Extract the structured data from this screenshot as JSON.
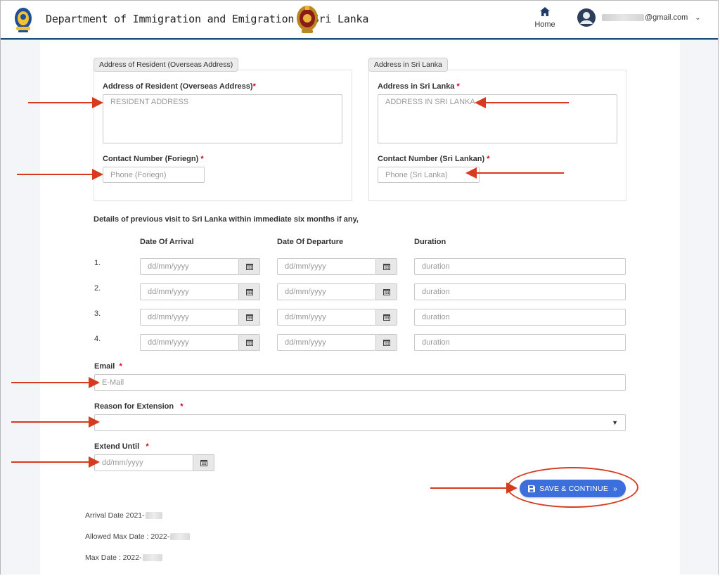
{
  "header": {
    "title": "Department of Immigration and Emigration - Sri Lanka",
    "home_label": "Home",
    "user_email_suffix": "@gmail.com"
  },
  "overseas": {
    "tag": "Address of Resident (Overseas Address)",
    "address_label": "Address of Resident (Overseas Address)",
    "address_placeholder": "RESIDENT ADDRESS",
    "phone_label": "Contact Number (Foriegn)",
    "phone_placeholder": "Phone (Foriegn)"
  },
  "srilanka": {
    "tag": "Address in Sri Lanka",
    "address_label": "Address in Sri Lanka",
    "address_placeholder": "ADDRESS IN SRI LANKA",
    "phone_label": "Contact Number (Sri Lankan)",
    "phone_placeholder": "Phone (Sri Lanka)"
  },
  "previous_visits": {
    "note": "Details of previous visit to Sri Lanka within immediate six months if any,",
    "columns": [
      "Date Of Arrival",
      "Date Of Departure",
      "Duration"
    ],
    "rows": [
      {
        "num": "1.",
        "arrival": "dd/mm/yyyy",
        "departure": "dd/mm/yyyy",
        "duration": "duration"
      },
      {
        "num": "2.",
        "arrival": "dd/mm/yyyy",
        "departure": "dd/mm/yyyy",
        "duration": "duration"
      },
      {
        "num": "3.",
        "arrival": "dd/mm/yyyy",
        "departure": "dd/mm/yyyy",
        "duration": "duration"
      },
      {
        "num": "4.",
        "arrival": "dd/mm/yyyy",
        "departure": "dd/mm/yyyy",
        "duration": "duration"
      }
    ]
  },
  "email": {
    "label": "Email",
    "placeholder": "E-Mail"
  },
  "reason": {
    "label": "Reason for Extension",
    "value": ""
  },
  "extend_until": {
    "label": "Extend Until",
    "placeholder": "dd/mm/yyyy"
  },
  "required_mark": "*",
  "save_button": {
    "label": "SAVE & CONTINUE",
    "suffix": "»"
  },
  "info": {
    "arrival_date": "Arrival Date 2021-",
    "allowed_max_date": "Allowed Max Date : 2022-",
    "max_date": "Max Date : 2022-"
  },
  "colors": {
    "accent_blue": "#3d6fdc",
    "header_rule": "#1f4d7a",
    "annotation_red": "#d63a1f",
    "required_red": "#d0021b"
  },
  "icons": {
    "home": "home-icon",
    "calendar": "calendar-icon",
    "save": "floppy-disk-icon",
    "dropdown": "caret-down-icon",
    "user": "user-avatar-icon"
  }
}
